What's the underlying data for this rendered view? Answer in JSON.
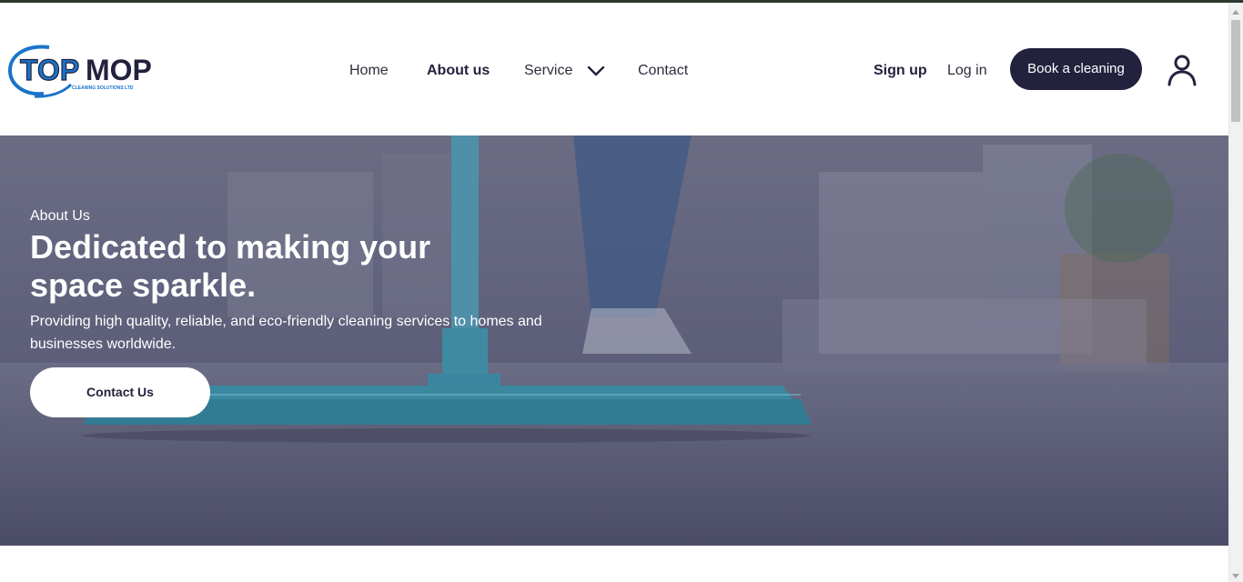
{
  "brand": {
    "logo_text_top": "TOP",
    "logo_text_mop": "MOP",
    "logo_tagline": "CLEANING SOLUTIONS LTD",
    "primary_color": "#22213e",
    "accent_color": "#1a73c9"
  },
  "nav": {
    "items": [
      {
        "label": "Home",
        "active": false
      },
      {
        "label": "About us",
        "active": true
      },
      {
        "label": "Service",
        "active": false,
        "has_dropdown": true
      },
      {
        "label": "Contact",
        "active": false
      }
    ]
  },
  "header_actions": {
    "signup_label": "Sign up",
    "login_label": "Log in",
    "book_label": "Book a cleaning",
    "account_icon": "user-icon"
  },
  "hero": {
    "eyebrow": "About Us",
    "title": "Dedicated to making your space sparkle.",
    "subtitle": "Providing high quality, reliable, and eco-friendly cleaning services to homes and businesses worldwide.",
    "cta_label": "Contact Us",
    "overlay_color": "#3c3d5e"
  }
}
